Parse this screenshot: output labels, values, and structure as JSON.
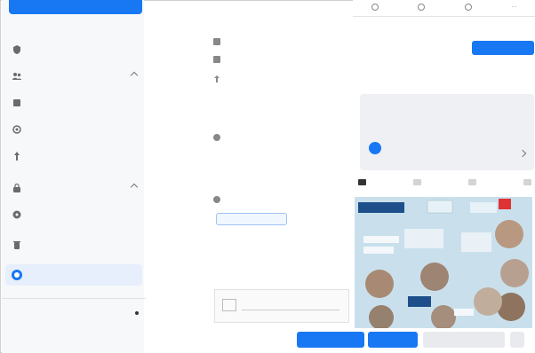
{
  "sidebar": {
    "top_button": "",
    "small_label": "",
    "items": [
      {
        "label": "",
        "icon": "shield-icon",
        "sub": ""
      },
      {
        "label": "",
        "icon": "users-icon",
        "sub": ""
      },
      {
        "label": "",
        "icon": "grid-icon",
        "sub": ""
      },
      {
        "label": "",
        "icon": "settings-icon",
        "sub": ""
      },
      {
        "label": "",
        "icon": "pin-icon",
        "sub": ""
      },
      {
        "label": "",
        "icon": "lock-icon",
        "sub": ""
      },
      {
        "label": "",
        "icon": "globe-icon",
        "sub": ""
      },
      {
        "label": "",
        "icon": "trash-icon",
        "sub": ""
      },
      {
        "label": "",
        "icon": "circle-icon",
        "sub": ""
      }
    ],
    "bottom_item": "",
    "title": ""
  },
  "center": {
    "link": "",
    "rows": [
      "",
      "",
      ""
    ],
    "paragraph1": "",
    "paragraph2": "",
    "chip": "",
    "paragraph3": ""
  },
  "right": {
    "tabs": [
      "",
      "",
      ""
    ],
    "number": "",
    "number_right": "",
    "stat_left_label": "",
    "stat_left_value": "",
    "stat_right_label": "",
    "stat_right_value": "",
    "button": "",
    "card_meta": "",
    "card_name": "",
    "card_sub": "",
    "tags": [
      "",
      "",
      "",
      ""
    ]
  },
  "bottom_bar": {
    "hint": "",
    "primary_button": "",
    "secondary_button": "",
    "tertiary_button": ""
  },
  "colors": {
    "accent": "#1877f2",
    "sidebar_bg": "#f7f8fa",
    "active_bg": "#e7eefc"
  }
}
